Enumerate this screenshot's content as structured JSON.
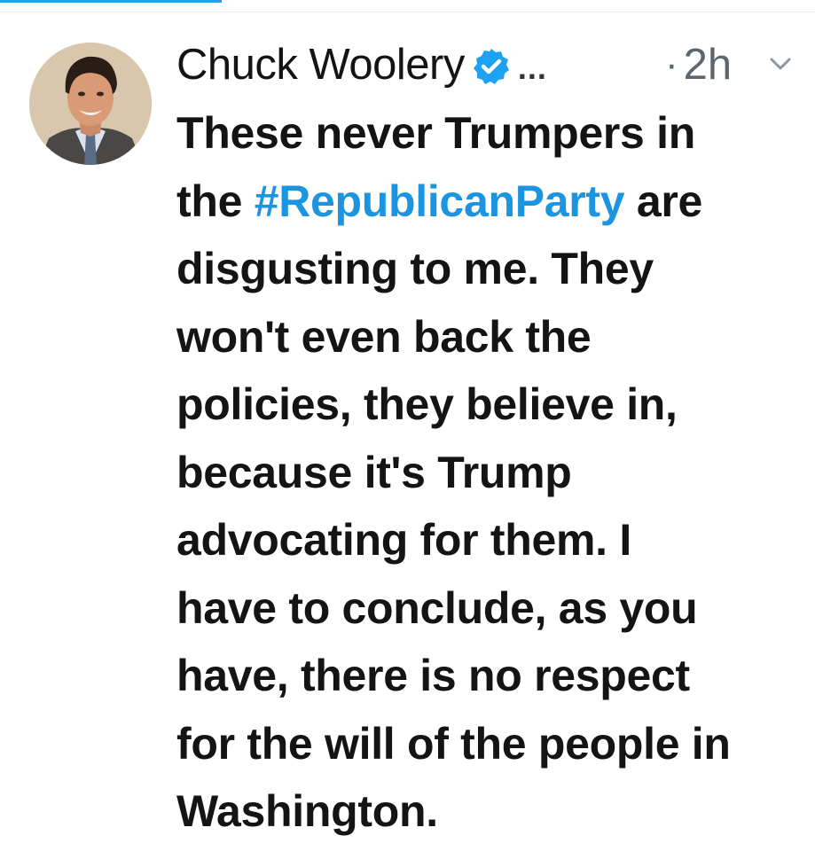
{
  "tweet": {
    "author_name": "Chuck Woolery",
    "more_label": "...",
    "time_dot": "·",
    "timestamp": "2h",
    "avatar_icon": "profile-photo",
    "verified_icon": "verified-badge-icon",
    "menu_icon": "chevron-down-icon",
    "hashtag_color": "#1b95e0",
    "text_lines": [
      {
        "before": "These never Trumpers in",
        "hashtag": "",
        "after": ""
      },
      {
        "before": "the ",
        "hashtag": "#RepublicanParty",
        "after": " are"
      },
      {
        "before": "disgusting to me. They",
        "hashtag": "",
        "after": ""
      },
      {
        "before": "won't even back the",
        "hashtag": "",
        "after": ""
      },
      {
        "before": "policies, they believe in,",
        "hashtag": "",
        "after": ""
      },
      {
        "before": "because it's Trump",
        "hashtag": "",
        "after": ""
      },
      {
        "before": "advocating for them. I",
        "hashtag": "",
        "after": ""
      },
      {
        "before": "have to conclude, as you",
        "hashtag": "",
        "after": ""
      },
      {
        "before": "have, there is no respect",
        "hashtag": "",
        "after": ""
      },
      {
        "before": "for the will of the people in",
        "hashtag": "",
        "after": ""
      },
      {
        "before": "Washington.",
        "hashtag": "",
        "after": ""
      }
    ]
  }
}
